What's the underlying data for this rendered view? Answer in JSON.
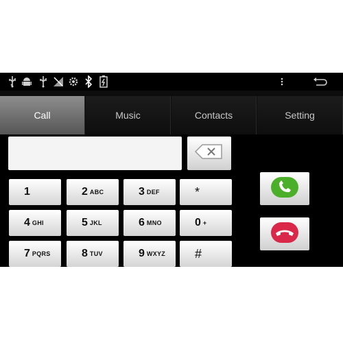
{
  "status_icons": [
    "usb-icon",
    "android-debug-icon",
    "usb-icon",
    "no-signal-icon",
    "settings-gear-icon",
    "bluetooth-icon",
    "battery-icon"
  ],
  "tabs": [
    {
      "label": "Call",
      "active": true
    },
    {
      "label": "Music",
      "active": false
    },
    {
      "label": "Contacts",
      "active": false
    },
    {
      "label": "Setting",
      "active": false
    }
  ],
  "dialer": {
    "number_value": "",
    "keys": [
      {
        "digit": "1",
        "letters": ""
      },
      {
        "digit": "2",
        "letters": "ABC"
      },
      {
        "digit": "3",
        "letters": "DEF"
      },
      {
        "digit": "*",
        "letters": ""
      },
      {
        "digit": "4",
        "letters": "GHI"
      },
      {
        "digit": "5",
        "letters": "JKL"
      },
      {
        "digit": "6",
        "letters": "MNO"
      },
      {
        "digit": "0",
        "letters": "+"
      },
      {
        "digit": "7",
        "letters": "PQRS"
      },
      {
        "digit": "8",
        "letters": "TUV"
      },
      {
        "digit": "9",
        "letters": "WXYZ"
      },
      {
        "digit": "#",
        "letters": ""
      }
    ]
  },
  "colors": {
    "answer": "#4caf2a",
    "hangup": "#d9284a",
    "active_tab": "#7a7a7a"
  }
}
